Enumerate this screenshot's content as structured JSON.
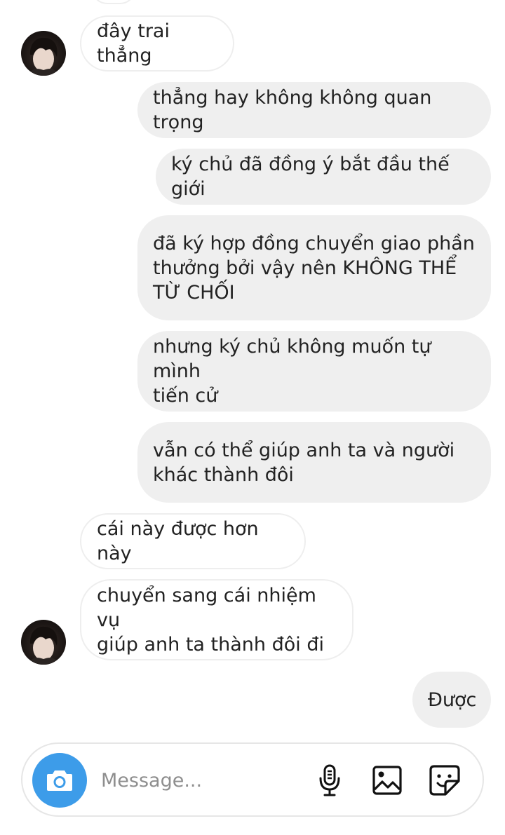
{
  "messages": [
    {
      "direction": "incoming",
      "text": "đây trai thẳng"
    },
    {
      "direction": "outgoing",
      "text": "thẳng hay không không quan trọng"
    },
    {
      "direction": "outgoing",
      "text": "ký chủ đã đồng ý bắt đầu thế giới"
    },
    {
      "direction": "outgoing",
      "text": "đã ký hợp đồng chuyển giao phần\nthưởng bởi vậy nên KHÔNG THỂ\nTỪ CHỐI"
    },
    {
      "direction": "outgoing",
      "text": "nhưng ký chủ không muốn tự mình\ntiến cử"
    },
    {
      "direction": "outgoing",
      "text": "vẫn có thể giúp anh ta và người\nkhác thành đôi"
    },
    {
      "direction": "incoming",
      "text": "cái này được hơn này"
    },
    {
      "direction": "incoming",
      "text": "chuyển sang cái nhiệm vụ\ngiúp anh ta thành đôi đi"
    },
    {
      "direction": "outgoing",
      "text": "Được"
    }
  ],
  "composer": {
    "placeholder": "Message...",
    "value": "",
    "icons": [
      "camera-icon",
      "microphone-icon",
      "image-gallery-icon",
      "sticker-icon"
    ]
  },
  "colors": {
    "accent": "#3d9ce9",
    "outgoing_bubble": "#efefef",
    "incoming_border": "#eeeeee",
    "text": "#222222",
    "placeholder": "#8e8e8e"
  }
}
